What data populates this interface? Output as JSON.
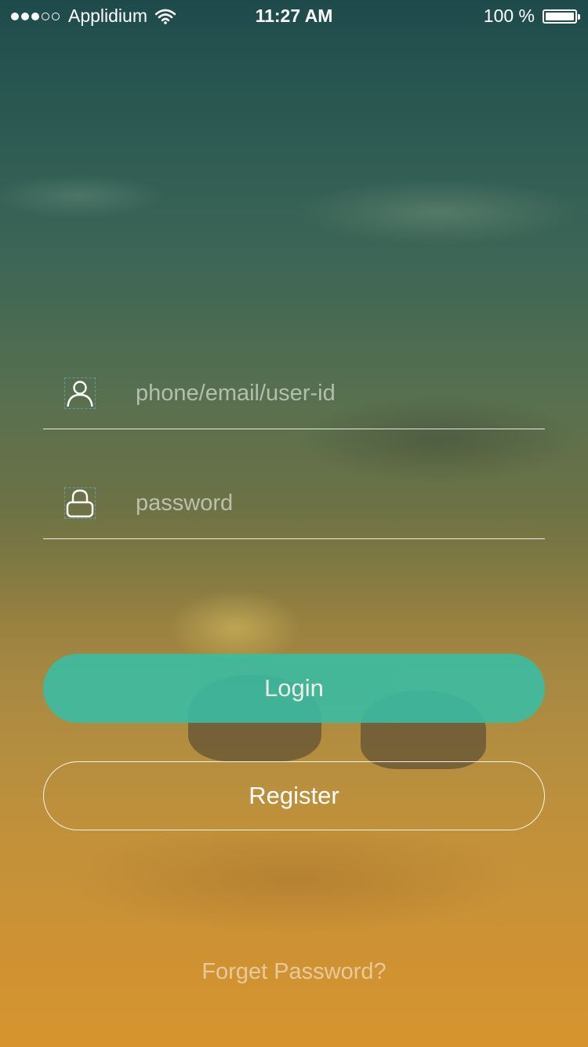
{
  "status_bar": {
    "signal_dots_filled": 3,
    "signal_dots_total": 5,
    "carrier": "Applidium",
    "wifi_icon": "wifi-icon",
    "time": "11:27 AM",
    "battery_text": "100 %",
    "battery_level": 1.0
  },
  "login_form": {
    "username": {
      "icon": "user-icon",
      "placeholder": "phone/email/user-id",
      "value": ""
    },
    "password": {
      "icon": "lock-icon",
      "placeholder": "password",
      "value": ""
    },
    "login_label": "Login",
    "register_label": "Register",
    "forgot_label": "Forget Password?"
  },
  "colors": {
    "login_button": "#38bea5",
    "text": "#ffffff"
  }
}
